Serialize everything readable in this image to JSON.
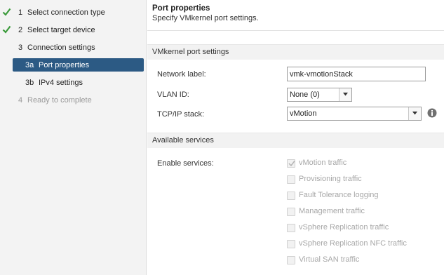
{
  "sidebar": {
    "steps": [
      {
        "num": "1",
        "label": "Select connection type",
        "status": "done"
      },
      {
        "num": "2",
        "label": "Select target device",
        "status": "done"
      },
      {
        "num": "3",
        "label": "Connection settings",
        "status": "current"
      },
      {
        "num": "3a",
        "label": "Port properties",
        "status": "active"
      },
      {
        "num": "3b",
        "label": "IPv4 settings",
        "status": "current"
      },
      {
        "num": "4",
        "label": "Ready to complete",
        "status": "pending"
      }
    ]
  },
  "main": {
    "title": "Port properties",
    "subtitle": "Specify VMkernel port settings.",
    "vmk_section": {
      "heading": "VMkernel port settings",
      "network_label": {
        "label": "Network label:",
        "value": "vmk-vmotionStack"
      },
      "vlan_id": {
        "label": "VLAN ID:",
        "value": "None (0)"
      },
      "tcpip_stack": {
        "label": "TCP/IP stack:",
        "value": "vMotion"
      }
    },
    "services_section": {
      "heading": "Available services",
      "enable_label": "Enable services:",
      "services": [
        {
          "label": "vMotion traffic",
          "checked": true
        },
        {
          "label": "Provisioning traffic",
          "checked": false
        },
        {
          "label": "Fault Tolerance logging",
          "checked": false
        },
        {
          "label": "Management traffic",
          "checked": false
        },
        {
          "label": "vSphere Replication traffic",
          "checked": false
        },
        {
          "label": "vSphere Replication NFC traffic",
          "checked": false
        },
        {
          "label": "Virtual SAN traffic",
          "checked": false
        }
      ]
    }
  },
  "colors": {
    "check_green": "#3a9a3a",
    "active_step_bg": "#2c5a84",
    "info_icon": "#707070"
  },
  "icons": {
    "done_step": "checkmark-icon",
    "dropdown": "chevron-down-icon",
    "help": "info-icon"
  }
}
